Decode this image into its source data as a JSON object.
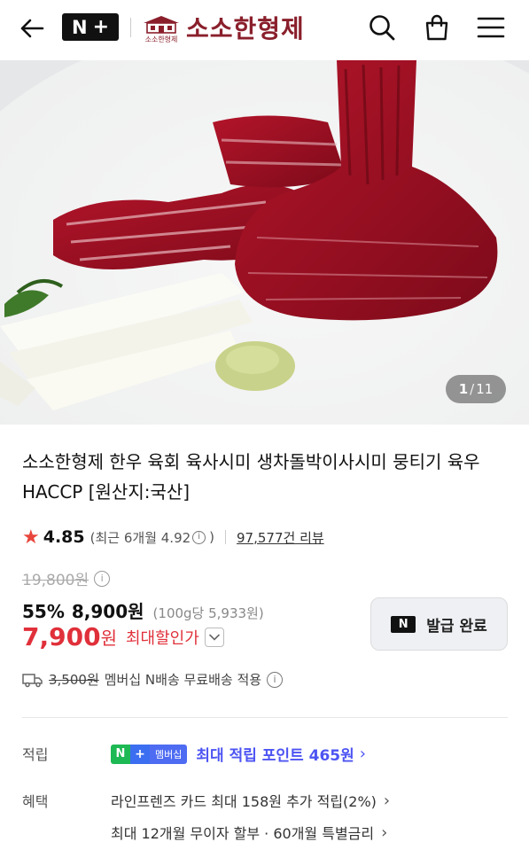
{
  "header": {
    "np_badge": {
      "n": "N",
      "plus": "+"
    },
    "brand_small": "소소한형제",
    "brand_name": "소소한형제",
    "icons": [
      "back-arrow-icon",
      "search-icon",
      "shopping-bag-icon",
      "menu-icon"
    ]
  },
  "gallery": {
    "current": "1",
    "separator": "/",
    "total": "11"
  },
  "product": {
    "title": "소소한형제 한우 육회 육사시미 생차돌박이사시미 뭉티기 육우 HACCP [원산지:국산]",
    "rating": "4.85",
    "recent_rating_label": "(최근 6개월 4.92",
    "recent_rating_close": ")",
    "review_count": "97,577건 리뷰",
    "original_price": "19,800원",
    "discount_rate": "55%",
    "sale_price": "8,900원",
    "unit_price": "(100g당 5,933원)",
    "final_price": "7,900",
    "final_price_unit": "원",
    "max_discount_label": "최대할인가",
    "coupon_button": {
      "logo": "N",
      "label": "발급 완료"
    },
    "shipping": {
      "original_fee": "3,500원",
      "text": "멤버십 N배송 무료배송 적용"
    }
  },
  "points": {
    "label": "적립",
    "badge_n": "N",
    "badge_plus": "+",
    "badge_text": "멤버십",
    "text": "최대 적립 포인트 465원"
  },
  "benefits": {
    "label": "혜택",
    "lines": [
      "라인프렌즈 카드 최대 158원 추가 적립(2%)",
      "최대 12개월 무이자 할부 · 60개월 특별금리"
    ]
  },
  "colors": {
    "brand": "#8a1f2b",
    "price_red": "#e0303a",
    "star": "#e8453c",
    "points_blue": "#4d54f2",
    "np_green": "#1db954"
  }
}
